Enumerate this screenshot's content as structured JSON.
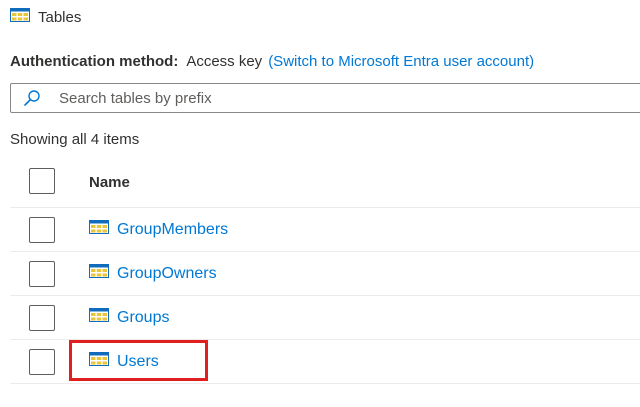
{
  "header": {
    "title": "Tables",
    "icon": "table-icon"
  },
  "auth": {
    "label": "Authentication method:",
    "value": "Access key",
    "switch_link": "(Switch to Microsoft Entra user account)"
  },
  "search": {
    "placeholder": "Search tables by prefix",
    "value": "",
    "icon": "search-icon"
  },
  "list": {
    "count_text": "Showing all 4 items",
    "columns": [
      "Name"
    ],
    "rows": [
      {
        "name": "GroupMembers",
        "icon": "table-icon",
        "selected": false
      },
      {
        "name": "GroupOwners",
        "icon": "table-icon",
        "selected": false
      },
      {
        "name": "Groups",
        "icon": "table-icon",
        "selected": false
      },
      {
        "name": "Users",
        "icon": "table-icon",
        "selected": false,
        "highlighted": true
      }
    ]
  },
  "colors": {
    "link": "#0078d4",
    "text": "#323130",
    "highlight": "#e01f1f",
    "table_icon_blue": "#0f6cbd",
    "table_icon_fill": "#e8c63a"
  }
}
